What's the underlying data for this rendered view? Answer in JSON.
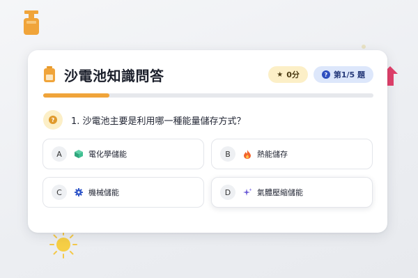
{
  "colors": {
    "accent": "#f0a43a",
    "score_bg": "#fcefc7",
    "progress_bg": "#dde7fb",
    "progress_text": "#263a7a"
  },
  "header": {
    "title": "沙電池知識問答",
    "title_icon": "battery-icon",
    "score_icon": "star-icon",
    "score_label": "0分",
    "progress_icon": "question-circle-icon",
    "progress_label": "第1/5 題"
  },
  "progress": {
    "value": 0.2
  },
  "question": {
    "icon": "question-mark-icon",
    "text": "1. 沙電池主要是利用哪一種能量儲存方式？"
  },
  "options": [
    {
      "letter": "A",
      "icon": "cube-icon",
      "text": "電化學儲能"
    },
    {
      "letter": "B",
      "icon": "flame-icon",
      "text": "熱能儲存"
    },
    {
      "letter": "C",
      "icon": "gear-icon",
      "text": "機械儲能"
    },
    {
      "letter": "D",
      "icon": "sparkle-icon",
      "text": "氣體壓縮儲能"
    }
  ]
}
